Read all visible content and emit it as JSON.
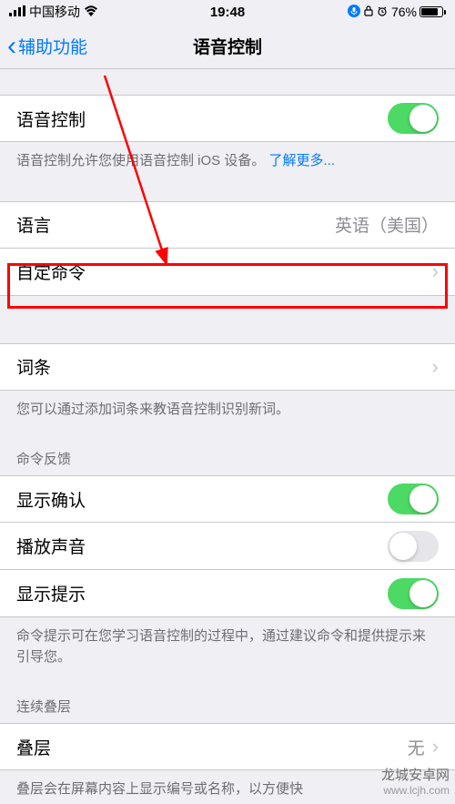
{
  "status": {
    "carrier": "中国移动",
    "time": "19:48",
    "battery_pct": "76%"
  },
  "nav": {
    "back_label": "辅助功能",
    "title": "语音控制"
  },
  "voice_control": {
    "label": "语音控制",
    "on": true,
    "footer_text": "语音控制允许您使用语音控制 iOS 设备。",
    "footer_link": "了解更多..."
  },
  "language": {
    "label": "语言",
    "value": "英语（美国）"
  },
  "custom_commands": {
    "label": "自定命令"
  },
  "vocabulary": {
    "label": "词条",
    "footer": "您可以通过添加词条来教语音控制识别新词。"
  },
  "feedback": {
    "header": "命令反馈",
    "show_confirmation": {
      "label": "显示确认",
      "on": true
    },
    "play_sound": {
      "label": "播放声音",
      "on": false
    },
    "show_hints": {
      "label": "显示提示",
      "on": true
    },
    "footer": "命令提示可在您学习语音控制的过程中，通过建议命令和提供提示来引导您。"
  },
  "overlay": {
    "header": "连续叠层",
    "label": "叠层",
    "value": "无",
    "footer": "叠层会在屏幕内容上显示编号或名称，以方便快"
  },
  "watermark": {
    "line1": "龙城安卓网",
    "line2": "www.lcjh.com"
  }
}
